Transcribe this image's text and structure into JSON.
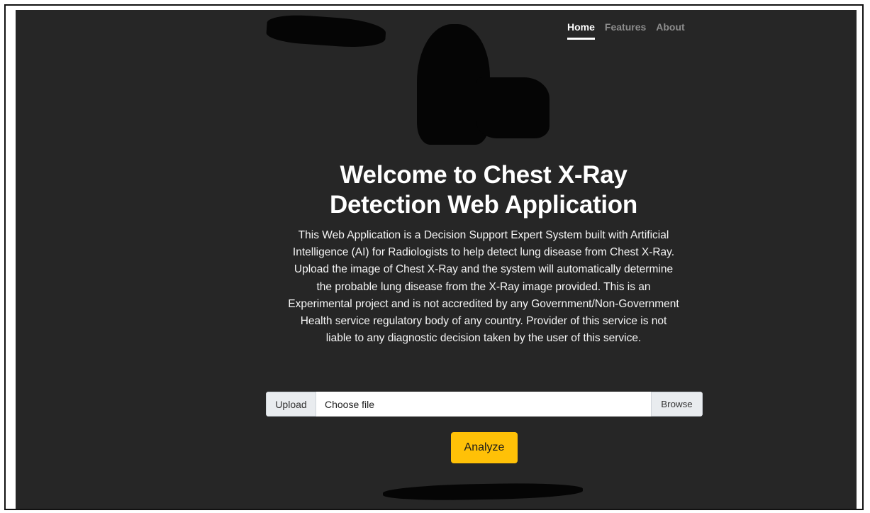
{
  "nav": {
    "items": [
      {
        "label": "Home",
        "active": true
      },
      {
        "label": "Features",
        "active": false
      },
      {
        "label": "About",
        "active": false
      }
    ]
  },
  "hero": {
    "title_line1": "Welcome to Chest X-Ray",
    "title_line2": "Detection Web Application",
    "description": "This Web Application is a Decision Support Expert System built with Artificial Intelligence (AI) for Radiologists to help detect lung disease from Chest X-Ray. Upload the image of Chest X-Ray and the system will automatically determine the probable lung disease from the X-Ray image provided. This is an Experimental project and is not accredited by any Government/Non-Government Health service regulatory body of any country. Provider of this service is not liable to any diagnostic decision taken by the user of this service."
  },
  "upload": {
    "prefix": "Upload",
    "placeholder": "Choose file",
    "browse_label": "Browse"
  },
  "actions": {
    "analyze_label": "Analyze"
  },
  "colors": {
    "background": "#262626",
    "accent": "#ffc107",
    "text": "#ffffff",
    "muted_nav": "#8d8d8d"
  }
}
